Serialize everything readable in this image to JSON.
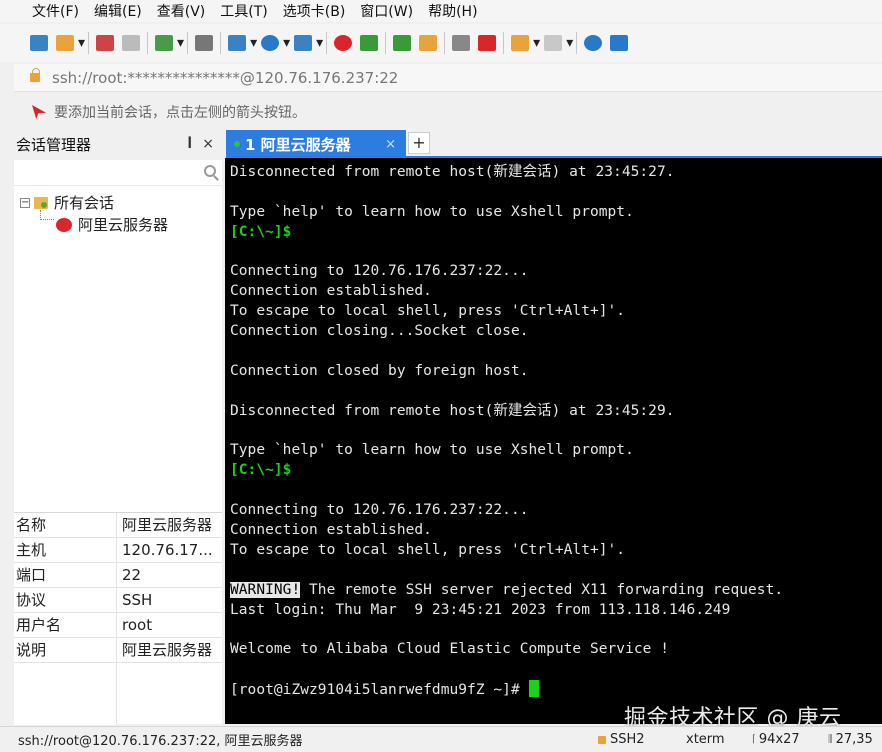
{
  "menu": [
    "文件(F)",
    "编辑(E)",
    "查看(V)",
    "工具(T)",
    "选项卡(B)",
    "窗口(W)",
    "帮助(H)"
  ],
  "toolbar": {
    "icons": [
      {
        "name": "new-session-icon",
        "color": "#3b82c4",
        "dropdown": false
      },
      {
        "name": "open-folder-icon",
        "color": "#e8a33a",
        "dropdown": true
      },
      {
        "name": "sep"
      },
      {
        "name": "connect-icon",
        "color": "#cc4444",
        "dropdown": false
      },
      {
        "name": "disconnect-icon",
        "color": "#bbbbbb",
        "dropdown": false
      },
      {
        "name": "sep"
      },
      {
        "name": "copy-session-icon",
        "color": "#4a9a48",
        "dropdown": true
      },
      {
        "name": "sep"
      },
      {
        "name": "find-icon",
        "color": "#777777",
        "dropdown": false
      },
      {
        "name": "sep"
      },
      {
        "name": "properties-icon",
        "color": "#3b82c4",
        "dropdown": true
      },
      {
        "name": "globe-icon",
        "color": "#2a78c8",
        "dropdown": true
      },
      {
        "name": "font-icon",
        "color": "#3b82c4",
        "dropdown": true
      },
      {
        "name": "sep"
      },
      {
        "name": "xshell-icon",
        "color": "#d8262b",
        "dropdown": false
      },
      {
        "name": "xftp-icon",
        "color": "#3a9a3a",
        "dropdown": false
      },
      {
        "name": "sep"
      },
      {
        "name": "fullscreen-icon",
        "color": "#3a9a3a",
        "dropdown": false
      },
      {
        "name": "lock-icon",
        "color": "#e8a33a",
        "dropdown": false
      },
      {
        "name": "sep"
      },
      {
        "name": "keyboard-icon",
        "color": "#888888",
        "dropdown": false
      },
      {
        "name": "highlight-icon",
        "color": "#d8262b",
        "dropdown": false
      },
      {
        "name": "sep"
      },
      {
        "name": "layout-icon",
        "color": "#e8a33a",
        "dropdown": true
      },
      {
        "name": "window-icon",
        "color": "#c8c8c8",
        "dropdown": true
      },
      {
        "name": "sep"
      },
      {
        "name": "help-icon",
        "color": "#2a78c8",
        "dropdown": false
      },
      {
        "name": "chat-icon",
        "color": "#2a78c8",
        "dropdown": false
      }
    ]
  },
  "address": "ssh://root:***************@120.76.176.237:22",
  "hint": "要添加当前会话，点击左侧的箭头按钮。",
  "session_manager": {
    "title": "会话管理器",
    "pin": "ᵖ",
    "close": "×",
    "tree": {
      "root_expander": "−",
      "root_label": "所有会话",
      "child_label": "阿里云服务器"
    },
    "props": [
      {
        "key": "名称",
        "value": "阿里云服务器"
      },
      {
        "key": "主机",
        "value": "120.76.17..."
      },
      {
        "key": "端口",
        "value": "22"
      },
      {
        "key": "协议",
        "value": "SSH"
      },
      {
        "key": "用户名",
        "value": "root"
      },
      {
        "key": "说明",
        "value": "阿里云服务器"
      }
    ]
  },
  "tab": {
    "label": "1 阿里云服务器",
    "close": "×",
    "new": "+"
  },
  "terminal": {
    "lines": [
      {
        "t": "Disconnected from remote host(新建会话) at 23:45:27."
      },
      {
        "t": ""
      },
      {
        "t": "Type `help' to learn how to use Xshell prompt."
      },
      {
        "t": "[C:\\~]$",
        "cls": "prompt"
      },
      {
        "t": ""
      },
      {
        "t": "Connecting to 120.76.176.237:22..."
      },
      {
        "t": "Connection established."
      },
      {
        "t": "To escape to local shell, press 'Ctrl+Alt+]'."
      },
      {
        "t": "Connection closing...Socket close."
      },
      {
        "t": ""
      },
      {
        "t": "Connection closed by foreign host."
      },
      {
        "t": ""
      },
      {
        "t": "Disconnected from remote host(新建会话) at 23:45:29."
      },
      {
        "t": ""
      },
      {
        "t": "Type `help' to learn how to use Xshell prompt."
      },
      {
        "t": "[C:\\~]$",
        "cls": "prompt"
      },
      {
        "t": ""
      },
      {
        "t": "Connecting to 120.76.176.237:22..."
      },
      {
        "t": "Connection established."
      },
      {
        "t": "To escape to local shell, press 'Ctrl+Alt+]'."
      },
      {
        "t": ""
      },
      {
        "warn": "WARNING!",
        "t": " The remote SSH server rejected X11 forwarding request."
      },
      {
        "t": "Last login: Thu Mar  9 23:45:21 2023 from 113.118.146.249"
      },
      {
        "t": ""
      },
      {
        "t": "Welcome to Alibaba Cloud Elastic Compute Service !"
      },
      {
        "t": ""
      },
      {
        "t": "[root@iZwz9104i5lanrwefdmu9fZ ~]# ",
        "cursor": true
      }
    ]
  },
  "watermark": "掘金技术社区 @ 庚云",
  "status": {
    "left": "ssh://root@120.76.176.237:22, 阿里云服务器",
    "protocol": "SSH2",
    "term": "xterm",
    "size": "94x27",
    "pos": "27,35",
    "size_icon": "⌈",
    "pos_icon": "⫼"
  }
}
